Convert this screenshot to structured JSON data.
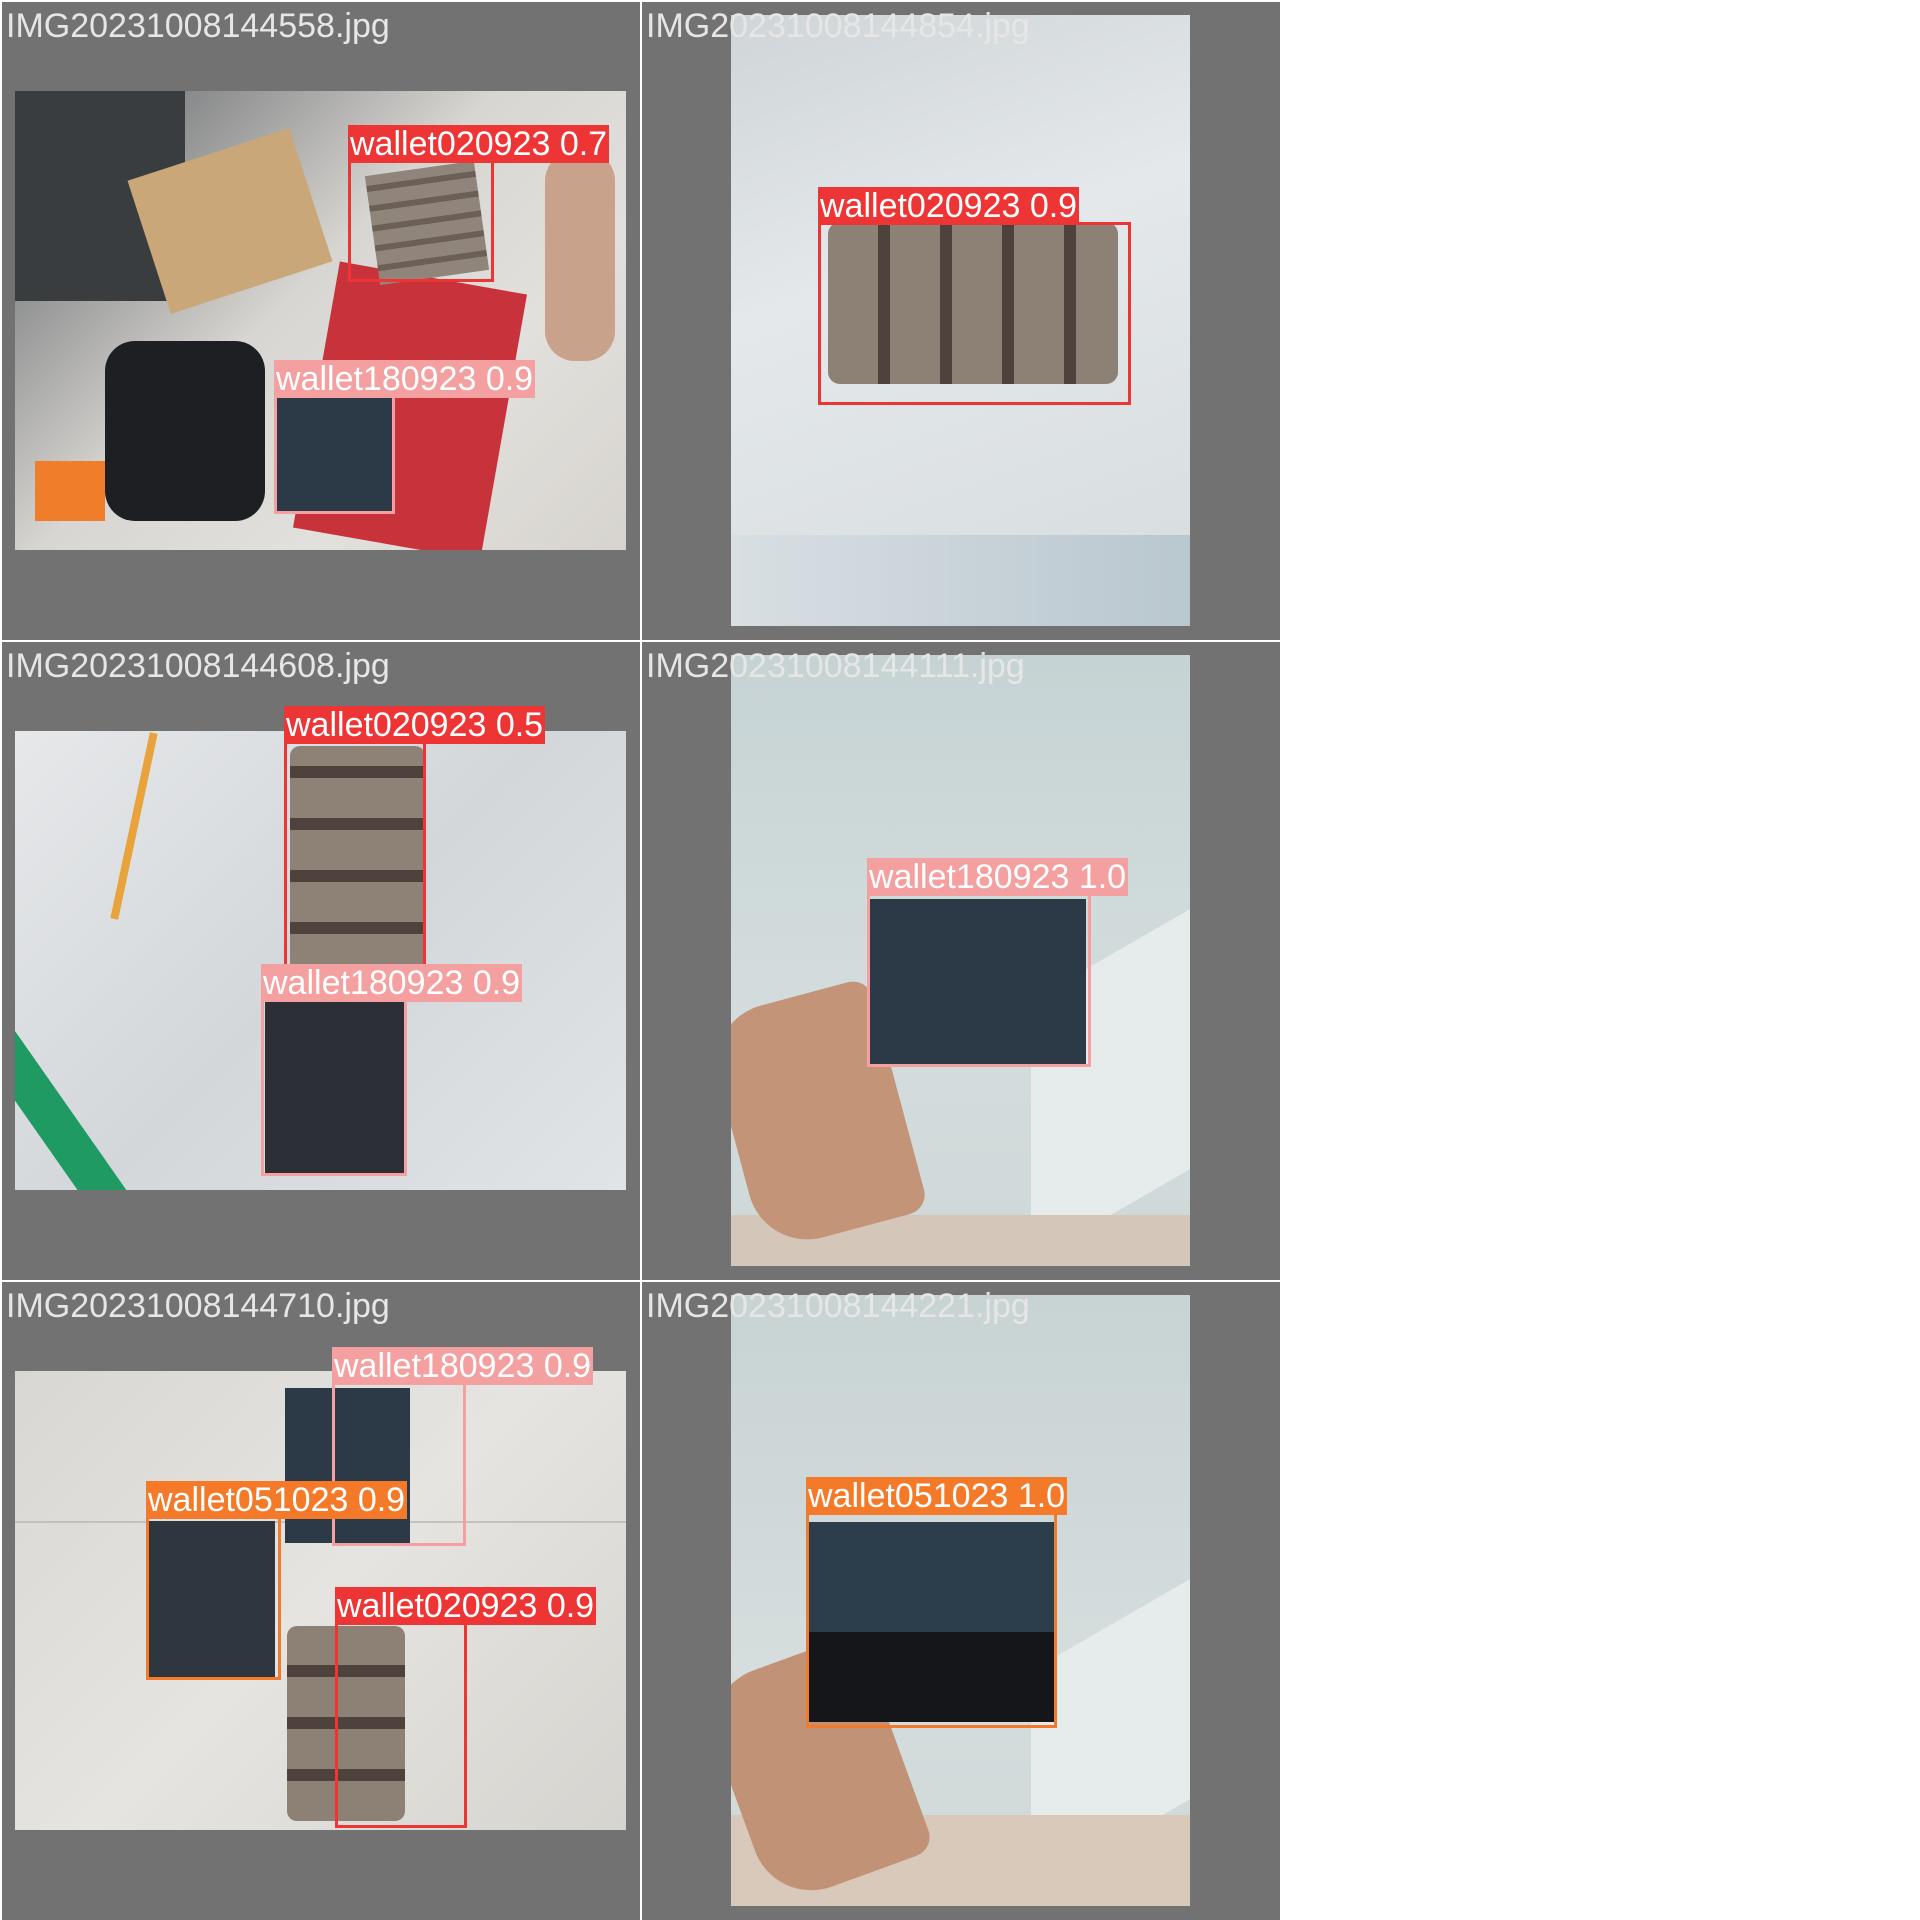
{
  "colors": {
    "wallet020923": "#ee3535",
    "wallet180923": "#f5a0a0",
    "wallet051023": "#f47a2a",
    "tile_bg": "#727272",
    "filename_text": "#e6e6e6"
  },
  "tiles": [
    {
      "filename": "IMG20231008144558.jpg",
      "detections": [
        {
          "label": "wallet020923 0.7"
        },
        {
          "label": "wallet180923 0.9"
        }
      ]
    },
    {
      "filename": "IMG20231008144854.jpg",
      "detections": [
        {
          "label": "wallet020923 0.9"
        }
      ]
    },
    {
      "filename": "IMG20231008144608.jpg",
      "detections": [
        {
          "label": "wallet020923 0.5"
        },
        {
          "label": "wallet180923 0.9"
        }
      ]
    },
    {
      "filename": "IMG20231008144111.jpg",
      "detections": [
        {
          "label": "wallet180923 1.0"
        }
      ]
    },
    {
      "filename": "IMG20231008144710.jpg",
      "detections": [
        {
          "label": "wallet180923 0.9"
        },
        {
          "label": "wallet051023 0.9"
        },
        {
          "label": "wallet020923 0.9"
        }
      ]
    },
    {
      "filename": "IMG20231008144221.jpg",
      "detections": [
        {
          "label": "wallet051023 1.0"
        }
      ]
    }
  ]
}
